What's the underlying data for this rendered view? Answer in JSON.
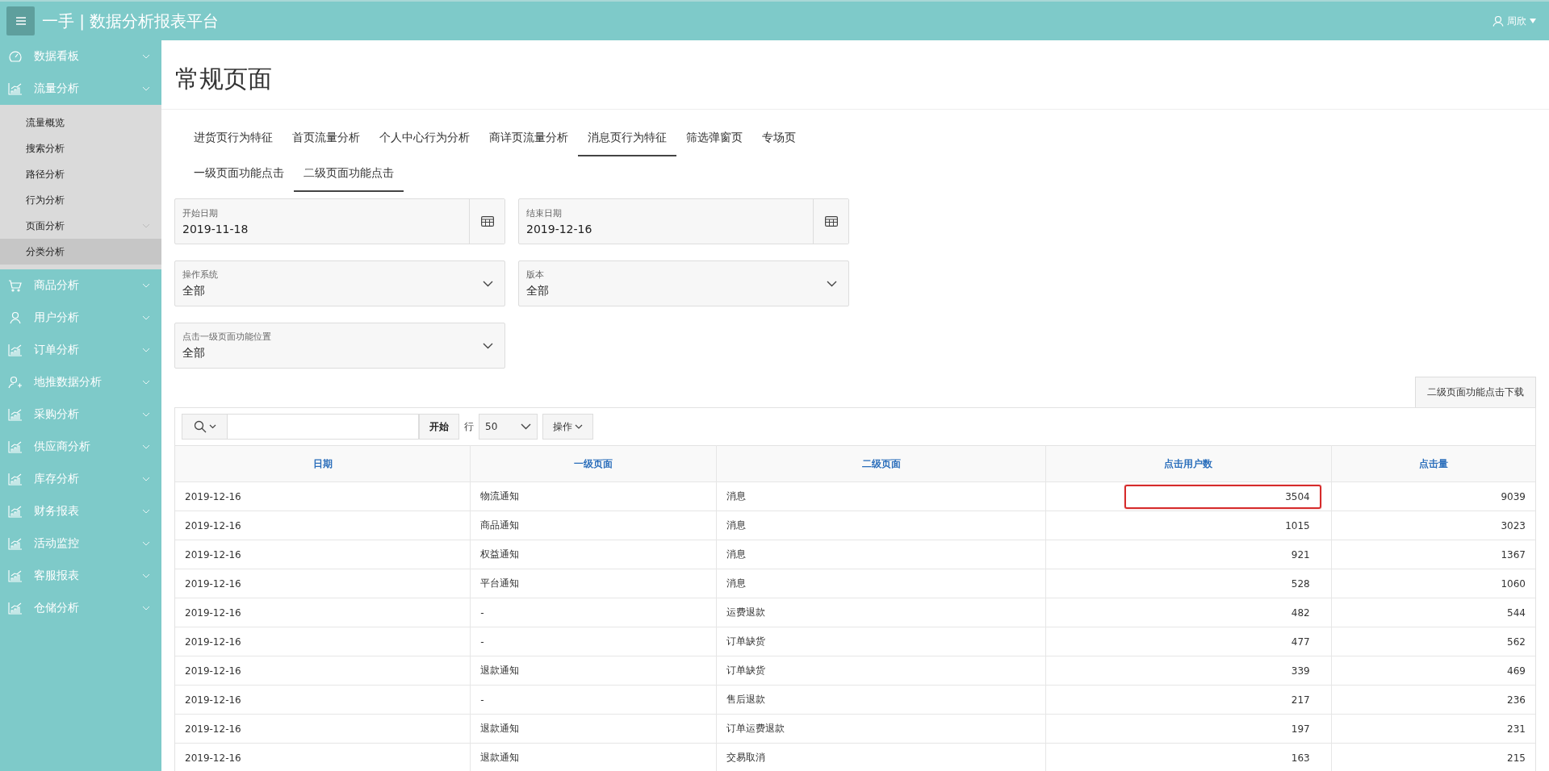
{
  "header": {
    "title": "一手 | 数据分析报表平台",
    "user": "周欣"
  },
  "sidebar": {
    "items": [
      {
        "label": "数据看板",
        "kind": "gauge"
      },
      {
        "label": "流量分析",
        "kind": "chart",
        "children": [
          {
            "label": "流量概览",
            "has_children": false,
            "selected": false
          },
          {
            "label": "搜索分析",
            "has_children": false,
            "selected": false
          },
          {
            "label": "路径分析",
            "has_children": false,
            "selected": false
          },
          {
            "label": "行为分析",
            "has_children": false,
            "selected": false
          },
          {
            "label": "页面分析",
            "has_children": true,
            "selected": false
          },
          {
            "label": "分类分析",
            "has_children": false,
            "selected": true
          }
        ]
      },
      {
        "label": "商品分析",
        "kind": "cart"
      },
      {
        "label": "用户分析",
        "kind": "user"
      },
      {
        "label": "订单分析",
        "kind": "chart"
      },
      {
        "label": "地推数据分析",
        "kind": "user-add"
      },
      {
        "label": "采购分析",
        "kind": "chart"
      },
      {
        "label": "供应商分析",
        "kind": "chart"
      },
      {
        "label": "库存分析",
        "kind": "chart"
      },
      {
        "label": "财务报表",
        "kind": "chart"
      },
      {
        "label": "活动监控",
        "kind": "chart"
      },
      {
        "label": "客服报表",
        "kind": "chart"
      },
      {
        "label": "仓储分析",
        "kind": "chart"
      }
    ]
  },
  "page_title": "常规页面",
  "tabs": [
    {
      "label": "进货页行为特征",
      "selected": false
    },
    {
      "label": "首页流量分析",
      "selected": false
    },
    {
      "label": "个人中心行为分析",
      "selected": false
    },
    {
      "label": "商详页流量分析",
      "selected": false
    },
    {
      "label": "消息页行为特征",
      "selected": true
    },
    {
      "label": "筛选弹窗页",
      "selected": false
    },
    {
      "label": "专场页",
      "selected": false
    }
  ],
  "subtabs": [
    {
      "label": "一级页面功能点击",
      "selected": false
    },
    {
      "label": "二级页面功能点击",
      "selected": true
    }
  ],
  "filters": [
    [
      {
        "kind": "date",
        "label": "开始日期",
        "value": "2019-11-18"
      },
      {
        "kind": "date",
        "label": "结束日期",
        "value": "2019-12-16"
      }
    ],
    [
      {
        "kind": "select",
        "label": "操作系统",
        "value": "全部"
      },
      {
        "kind": "select",
        "label": "版本",
        "value": "全部"
      }
    ],
    [
      {
        "kind": "select",
        "label": "点击一级页面功能位置",
        "value": "全部"
      }
    ]
  ],
  "download_button": "二级页面功能点击下载",
  "toolbar": {
    "go_button": "开始",
    "rows_label": "行",
    "rows_value": "50",
    "actions_button": "操作"
  },
  "table": {
    "columns": [
      "日期",
      "一级页面",
      "二级页面",
      "点击用户数",
      "点击量"
    ],
    "rows": [
      {
        "date": "2019-12-16",
        "level1": "物流通知",
        "level2": "消息",
        "users": "3504",
        "clicks": "9039",
        "highlighted": true
      },
      {
        "date": "2019-12-16",
        "level1": "商品通知",
        "level2": "消息",
        "users": "1015",
        "clicks": "3023",
        "highlighted": false
      },
      {
        "date": "2019-12-16",
        "level1": "权益通知",
        "level2": "消息",
        "users": "921",
        "clicks": "1367",
        "highlighted": false
      },
      {
        "date": "2019-12-16",
        "level1": "平台通知",
        "level2": "消息",
        "users": "528",
        "clicks": "1060",
        "highlighted": false
      },
      {
        "date": "2019-12-16",
        "level1": "-",
        "level2": "运费退款",
        "users": "482",
        "clicks": "544",
        "highlighted": false
      },
      {
        "date": "2019-12-16",
        "level1": "-",
        "level2": "订单缺货",
        "users": "477",
        "clicks": "562",
        "highlighted": false
      },
      {
        "date": "2019-12-16",
        "level1": "退款通知",
        "level2": "订单缺货",
        "users": "339",
        "clicks": "469",
        "highlighted": false
      },
      {
        "date": "2019-12-16",
        "level1": "-",
        "level2": "售后退款",
        "users": "217",
        "clicks": "236",
        "highlighted": false
      },
      {
        "date": "2019-12-16",
        "level1": "退款通知",
        "level2": "订单运费退款",
        "users": "197",
        "clicks": "231",
        "highlighted": false
      },
      {
        "date": "2019-12-16",
        "level1": "退款通知",
        "level2": "交易取消",
        "users": "163",
        "clicks": "215",
        "highlighted": false
      }
    ]
  }
}
